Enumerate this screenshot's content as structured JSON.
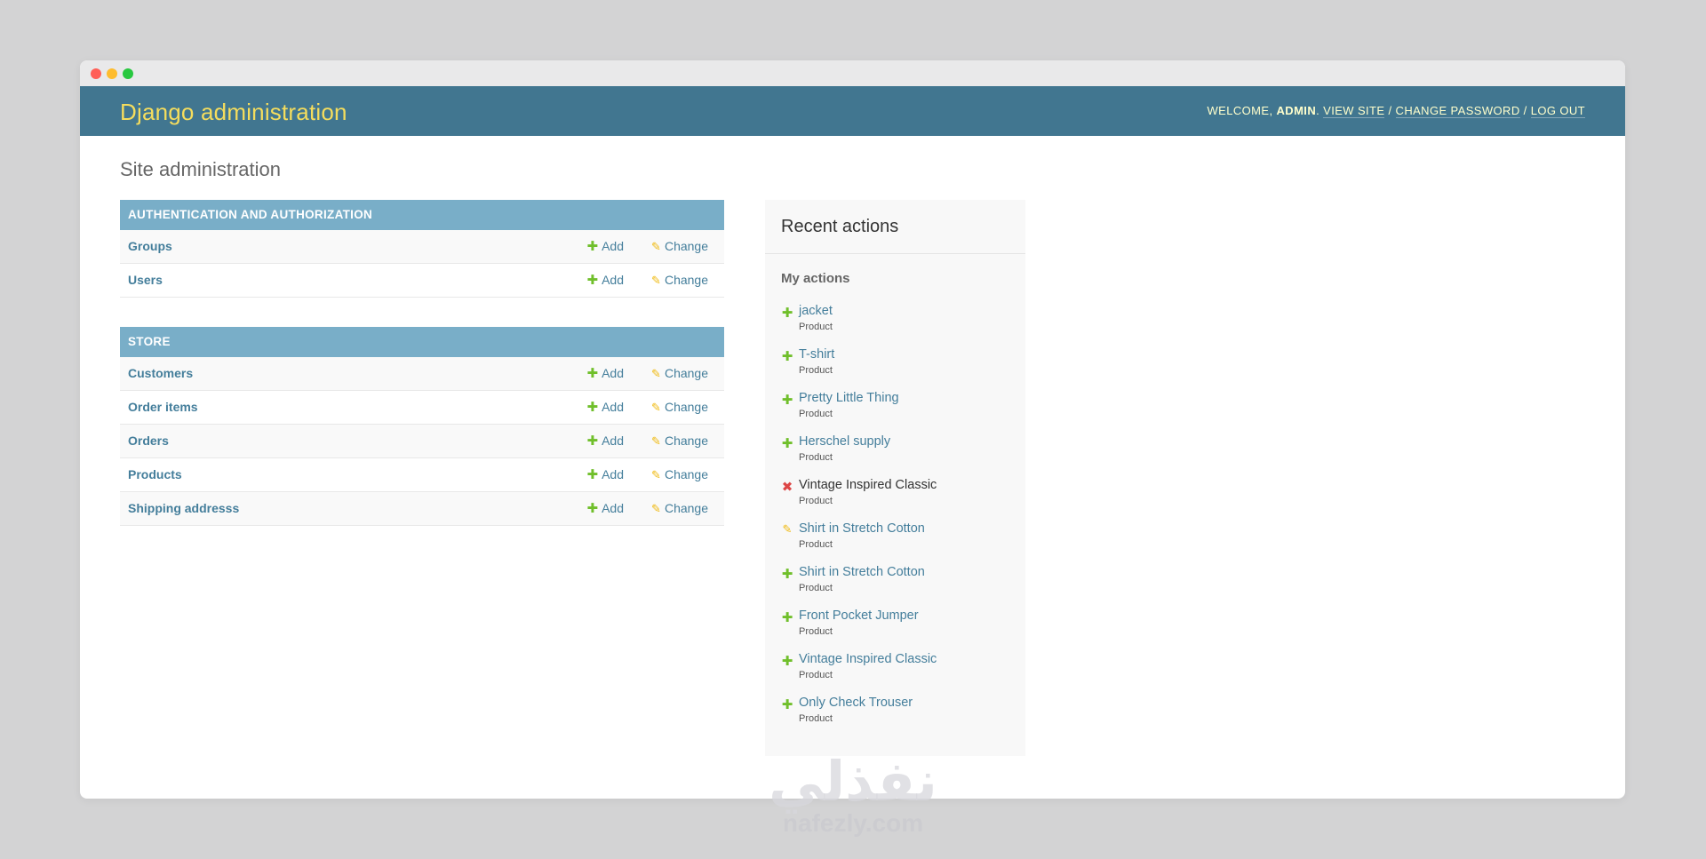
{
  "header": {
    "branding": "Django administration",
    "welcome": "Welcome,",
    "username": "admin",
    "links": {
      "view_site": "View site",
      "change_password": "Change password",
      "log_out": "Log out"
    }
  },
  "page": {
    "title": "Site administration"
  },
  "modules": [
    {
      "caption": "Authentication and Authorization",
      "models": [
        {
          "name": "Groups",
          "add": "Add",
          "change": "Change"
        },
        {
          "name": "Users",
          "add": "Add",
          "change": "Change"
        }
      ]
    },
    {
      "caption": "Store",
      "models": [
        {
          "name": "Customers",
          "add": "Add",
          "change": "Change"
        },
        {
          "name": "Order items",
          "add": "Add",
          "change": "Change"
        },
        {
          "name": "Orders",
          "add": "Add",
          "change": "Change"
        },
        {
          "name": "Products",
          "add": "Add",
          "change": "Change"
        },
        {
          "name": "Shipping addresss",
          "add": "Add",
          "change": "Change"
        }
      ]
    }
  ],
  "recent_actions": {
    "title": "Recent actions",
    "subtitle": "My actions",
    "items": [
      {
        "icon": "plus-icon",
        "name": "jacket",
        "type": "Product"
      },
      {
        "icon": "plus-icon",
        "name": "T-shirt",
        "type": "Product"
      },
      {
        "icon": "plus-icon",
        "name": "Pretty Little Thing",
        "type": "Product"
      },
      {
        "icon": "plus-icon",
        "name": "Herschel supply",
        "type": "Product"
      },
      {
        "icon": "delete-icon",
        "name": "Vintage Inspired Classic",
        "type": "Product"
      },
      {
        "icon": "pencil-icon",
        "name": "Shirt in Stretch Cotton",
        "type": "Product"
      },
      {
        "icon": "plus-icon",
        "name": "Shirt in Stretch Cotton",
        "type": "Product"
      },
      {
        "icon": "plus-icon",
        "name": "Front Pocket Jumper",
        "type": "Product"
      },
      {
        "icon": "plus-icon",
        "name": "Vintage Inspired Classic",
        "type": "Product"
      },
      {
        "icon": "plus-icon",
        "name": "Only Check Trouser",
        "type": "Product"
      }
    ]
  },
  "watermark": {
    "logo": "نفذلي",
    "url": "nafezly.com"
  },
  "colors": {
    "header_bg": "#417690",
    "branding": "#f5dd5d",
    "caption_bg": "#79aec8",
    "link": "#447e9b",
    "add_icon": "#70bf2b",
    "change_icon": "#efb80b",
    "delete_icon": "#dd4646"
  }
}
